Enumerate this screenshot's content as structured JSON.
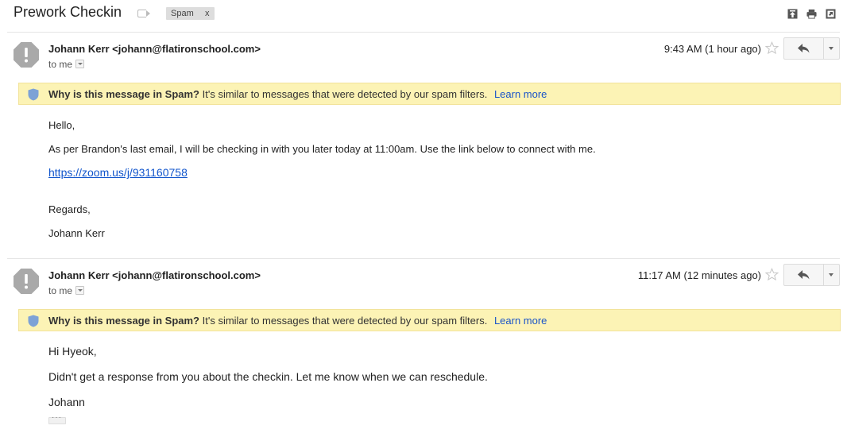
{
  "thread": {
    "subject": "Prework Checkin",
    "label": "Spam",
    "label_remove": "x"
  },
  "toolbar": {
    "icons": [
      "move-to-top-icon",
      "print-icon",
      "open-new-window-icon"
    ]
  },
  "messages": [
    {
      "sender": "Johann Kerr <johann@flatironschool.com>",
      "to": "to me",
      "time": "9:43 AM (1 hour ago)",
      "spam_banner": {
        "title": "Why is this message in Spam?",
        "text": "It's similar to messages that were detected by our spam filters.",
        "link": "Learn more"
      },
      "body": {
        "greeting": "Hello,",
        "line1": "As per Brandon's last email, I will be checking in with you later today at 11:00am. Use the link below to connect with me.",
        "link": "https://zoom.us/j/931160758",
        "closing": "Regards,",
        "signature": "Johann Kerr"
      }
    },
    {
      "sender": "Johann Kerr <johann@flatironschool.com>",
      "to": "to me",
      "time": "11:17 AM (12 minutes ago)",
      "spam_banner": {
        "title": "Why is this message in Spam?",
        "text": "It's similar to messages that were detected by our spam filters.",
        "link": "Learn more"
      },
      "body": {
        "greeting": "Hi Hyeok,",
        "line1": "Didn't get a response from you about the checkin. Let me know when we can reschedule.",
        "signature": "Johann"
      }
    }
  ],
  "colors": {
    "banner_bg": "#fcf3b5",
    "link": "#1155cc",
    "shield": "#7da2d6"
  }
}
